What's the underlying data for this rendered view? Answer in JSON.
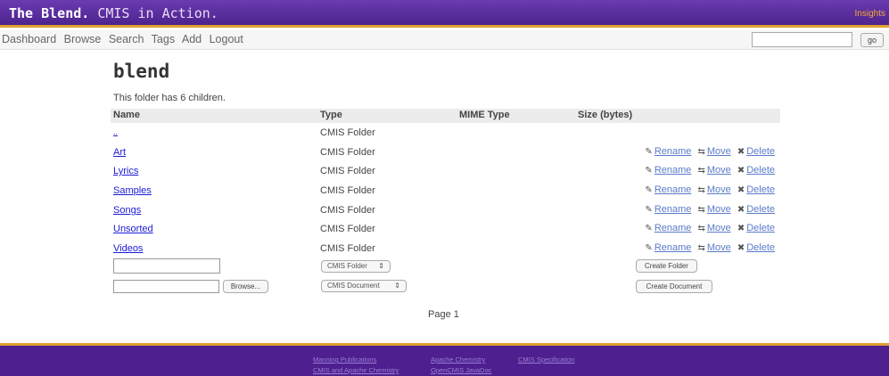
{
  "header": {
    "brand_bold": "The Blend.",
    "brand_rest": " CMIS in Action.",
    "insights": "Insights"
  },
  "nav": {
    "items": [
      "Dashboard",
      "Browse",
      "Search",
      "Tags",
      "Add",
      "Logout"
    ],
    "search_value": "",
    "go_label": "go"
  },
  "folder": {
    "title": "blend",
    "children_note": "This folder has 6 children."
  },
  "table": {
    "headers": {
      "name": "Name",
      "type": "Type",
      "mime": "MIME Type",
      "size": "Size (bytes)"
    },
    "parent": {
      "name": "..",
      "type": "CMIS Folder"
    },
    "rows": [
      {
        "name": "Art",
        "type": "CMIS Folder"
      },
      {
        "name": "Lyrics",
        "type": "CMIS Folder"
      },
      {
        "name": "Samples",
        "type": "CMIS Folder"
      },
      {
        "name": "Songs",
        "type": "CMIS Folder"
      },
      {
        "name": "Unsorted",
        "type": "CMIS Folder"
      },
      {
        "name": "Videos",
        "type": "CMIS Folder"
      }
    ],
    "actions": {
      "rename": "Rename",
      "move": "Move",
      "delete": "Delete"
    }
  },
  "create": {
    "folder_name_value": "",
    "folder_type": "CMIS Folder",
    "folder_button": "Create Folder",
    "file_value": "",
    "browse_button": "Browse...",
    "doc_type": "CMIS Document",
    "doc_button": "Create Document"
  },
  "pager": {
    "label": "Page 1"
  },
  "footer": {
    "links": [
      "Manning Publications",
      "Apache Chemistry",
      "CMIS Specification",
      "CMIS and Apache Chemistry",
      "OpenCMIS JavaDoc"
    ]
  }
}
